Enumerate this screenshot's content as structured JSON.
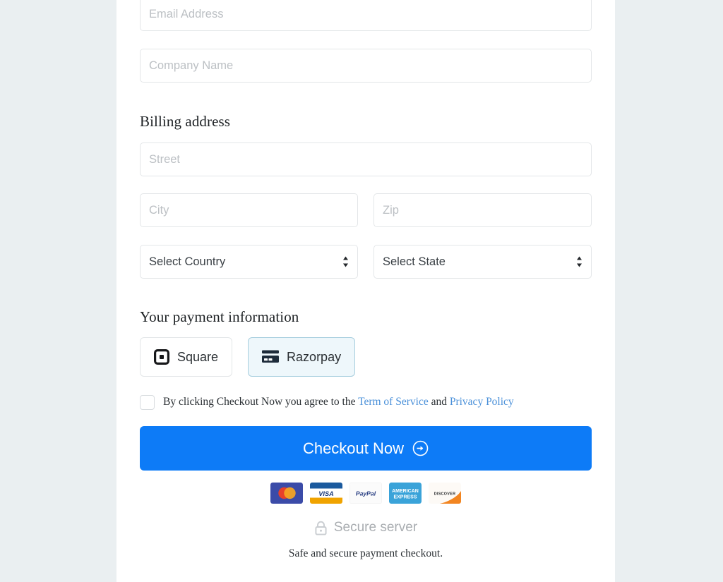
{
  "colors": {
    "page_background": "#eaeff1",
    "card_background": "#ffffff",
    "primary_button": "#0d7bf7",
    "link": "#4a90d9",
    "selected_method_border": "#a7cede",
    "selected_method_background": "#eef7fb",
    "placeholder": "#bcc0c4",
    "secure_text": "#a9adb1"
  },
  "form": {
    "email": {
      "placeholder": "Email Address",
      "value": ""
    },
    "company": {
      "placeholder": "Company Name",
      "value": ""
    }
  },
  "billing": {
    "heading": "Billing address",
    "street": {
      "placeholder": "Street",
      "value": ""
    },
    "city": {
      "placeholder": "City",
      "value": ""
    },
    "zip": {
      "placeholder": "Zip",
      "value": ""
    },
    "country": {
      "selected": "Select Country"
    },
    "state": {
      "selected": "Select State"
    }
  },
  "payment": {
    "heading": "Your payment information",
    "methods": [
      {
        "label": "Square",
        "icon": "square-logo-icon",
        "selected": false
      },
      {
        "label": "Razorpay",
        "icon": "credit-card-icon",
        "selected": true
      }
    ]
  },
  "terms": {
    "checked": false,
    "text_before": "By clicking Checkout Now you agree to the ",
    "link_terms": "Term of Service",
    "text_between": " and ",
    "link_privacy": "Privacy Policy"
  },
  "checkout": {
    "label": "Checkout Now",
    "icon": "arrow-right-circle-icon"
  },
  "footer": {
    "card_logos": [
      {
        "name": "mastercard-logo"
      },
      {
        "name": "visa-logo",
        "text": "VISA"
      },
      {
        "name": "paypal-logo",
        "text": "PayPal"
      },
      {
        "name": "amex-logo",
        "text_line1": "AMERICAN",
        "text_line2": "EXPRESS"
      },
      {
        "name": "discover-logo",
        "text": "DISCOVER"
      }
    ],
    "secure_icon": "lock-icon",
    "secure_label": "Secure server",
    "safe_note": "Safe and secure payment checkout."
  }
}
